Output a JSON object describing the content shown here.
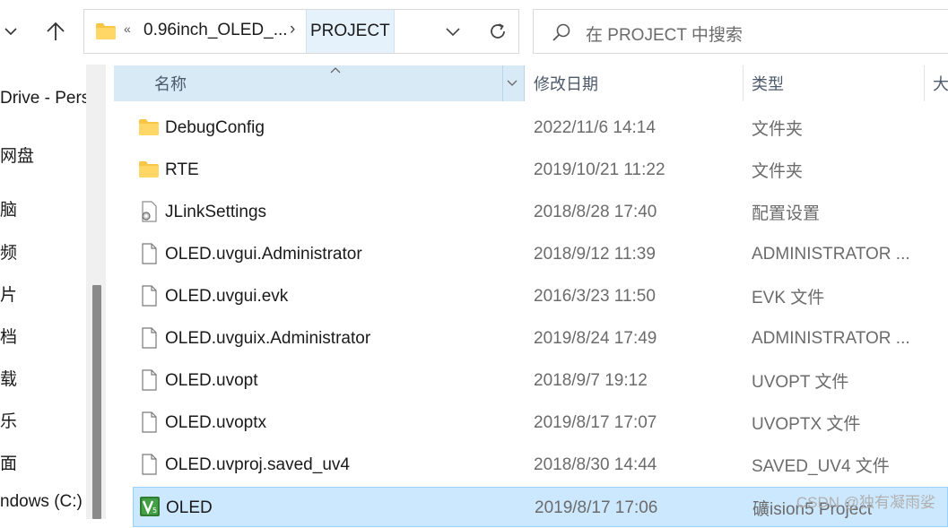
{
  "address_bar": {
    "overflow_glyph": "«",
    "crumb_parent": "0.96inch_OLED_...",
    "crumb_separator": "›",
    "crumb_current": "PROJECT"
  },
  "search": {
    "placeholder": "在 PROJECT 中搜索"
  },
  "sidebar": {
    "items": [
      {
        "label": "Drive - Pers"
      },
      {
        "label": "网盘"
      },
      {
        "label": "脑"
      },
      {
        "label": "频"
      },
      {
        "label": "片"
      },
      {
        "label": "档"
      },
      {
        "label": "载"
      },
      {
        "label": "乐"
      },
      {
        "label": "面"
      },
      {
        "label": "ndows (C:)"
      }
    ]
  },
  "columns": {
    "name": "名称",
    "date": "修改日期",
    "type": "类型",
    "size": "大"
  },
  "files": [
    {
      "name": "DebugConfig",
      "date": "2022/11/6 14:14",
      "type": "文件夹",
      "icon": "folder-icon"
    },
    {
      "name": "RTE",
      "date": "2019/10/21 11:22",
      "type": "文件夹",
      "icon": "folder-icon"
    },
    {
      "name": "JLinkSettings",
      "date": "2018/8/28 17:40",
      "type": "配置设置",
      "icon": "settings-file-icon"
    },
    {
      "name": "OLED.uvgui.Administrator",
      "date": "2018/9/12 11:39",
      "type": "ADMINISTRATOR ...",
      "icon": "file-icon"
    },
    {
      "name": "OLED.uvgui.evk",
      "date": "2016/3/23 11:50",
      "type": "EVK 文件",
      "icon": "file-icon"
    },
    {
      "name": "OLED.uvguix.Administrator",
      "date": "2019/8/24 17:49",
      "type": "ADMINISTRATOR ...",
      "icon": "file-icon"
    },
    {
      "name": "OLED.uvopt",
      "date": "2018/9/7 19:12",
      "type": "UVOPT 文件",
      "icon": "file-icon"
    },
    {
      "name": "OLED.uvoptx",
      "date": "2019/8/17 17:07",
      "type": "UVOPTX 文件",
      "icon": "file-icon"
    },
    {
      "name": "OLED.uvproj.saved_uv4",
      "date": "2018/8/30 14:44",
      "type": "SAVED_UV4 文件",
      "icon": "file-icon"
    },
    {
      "name": "OLED",
      "date": "2019/8/17 17:06",
      "type": "礦ision5 Project",
      "icon": "keil-project-icon",
      "selected": true
    }
  ],
  "watermark": "CSDN @独有凝雨娑",
  "colors": {
    "header_bg": "#d9eaf7",
    "selected_row_bg": "#cce8ff",
    "selected_row_border": "#99d1ff",
    "folder_yellow": "#f8c644",
    "keil_green": "#2e7d32"
  }
}
